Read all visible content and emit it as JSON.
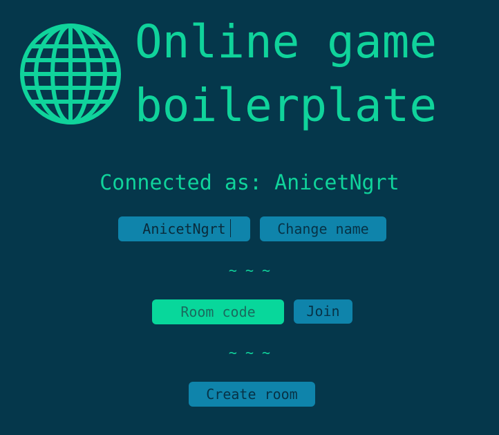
{
  "header": {
    "title_line1": "Online game",
    "title_line2": "boilerplate",
    "logo_icon": "globe-icon"
  },
  "status": {
    "prefix": "Connected as: ",
    "username": "AnicetNgrt"
  },
  "name_form": {
    "value": "AnicetNgrt",
    "change_label": "Change name"
  },
  "separator": "~ ~ ~",
  "room_form": {
    "placeholder": "Room code",
    "join_label": "Join"
  },
  "create_label": "Create room",
  "colors": {
    "background": "#05374b",
    "accent": "#10d39b",
    "button": "#0f84ab",
    "room_input": "#08d79b"
  }
}
